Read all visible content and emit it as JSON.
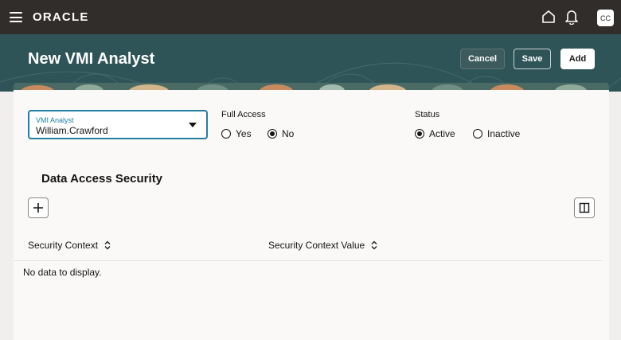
{
  "topbar": {
    "brand": "ORACLE",
    "avatar_initials": "CC",
    "icons": [
      "hamburger-icon",
      "home-icon",
      "bell-icon"
    ]
  },
  "header": {
    "title": "New VMI Analyst",
    "cancel_label": "Cancel",
    "save_label": "Save",
    "add_label": "Add"
  },
  "form": {
    "analyst": {
      "label": "VMI Analyst",
      "value": "William.Crawford"
    },
    "full_access": {
      "label": "Full Access",
      "options": [
        "Yes",
        "No"
      ],
      "selected": "No"
    },
    "status": {
      "label": "Status",
      "options": [
        "Active",
        "Inactive"
      ],
      "selected": "Active"
    }
  },
  "security": {
    "title": "Data Access Security",
    "columns": [
      "Security Context",
      "Security Context Value"
    ],
    "empty_text": "No data to display."
  },
  "colors": {
    "topbar": "#312d2a",
    "header_band": "#2e5457",
    "focus_accent": "#227e9e",
    "card": "#fbf9f8",
    "page_bg": "#f1efed"
  }
}
